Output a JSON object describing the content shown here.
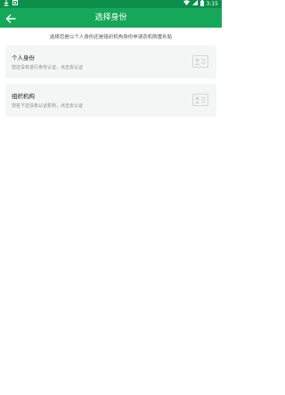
{
  "status_bar": {
    "time": "3:15",
    "icons": [
      "download-icon",
      "notification-icon",
      "wifi-icon",
      "signal-icon",
      "battery-icon"
    ]
  },
  "app_bar": {
    "title": "选择身份",
    "back_icon": "back-arrow-icon",
    "background": "#16a85a",
    "status_background": "#0d8f4c"
  },
  "hint": "选择您是以个人身份还是组织机构身份申请农机购置补贴",
  "cards": {
    "personal": {
      "title": "个人身份",
      "subtitle": "您还没有进行身份认证，点击去认证",
      "icon": "id-card-icon"
    },
    "organization": {
      "title": "组织机构",
      "subtitle": "您名下还没有认证机构，点击去认证",
      "icon": "id-card-icon"
    }
  }
}
